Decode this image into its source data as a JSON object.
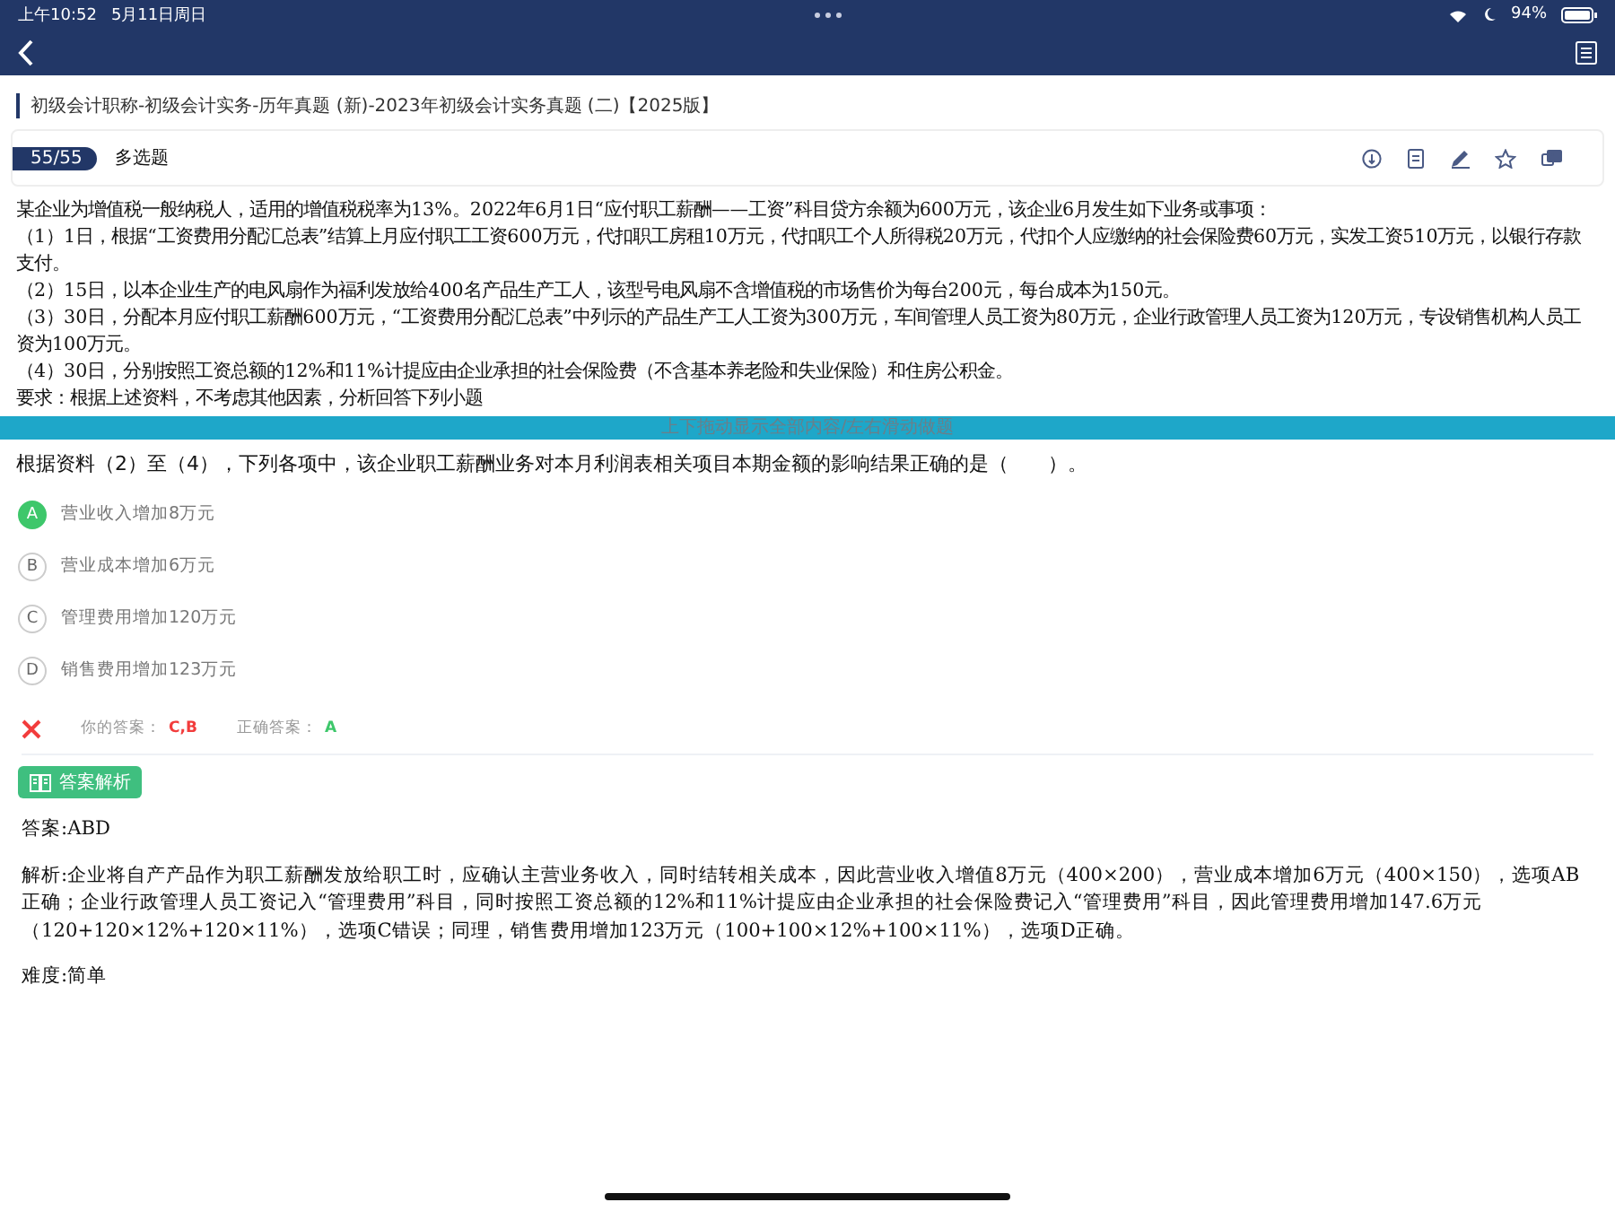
{
  "status_bar": {
    "time": "上午10:52",
    "date": "5月11日周日",
    "battery": "94%"
  },
  "breadcrumb": "初级会计职称-初级会计实务-历年真题 (新)-2023年初级会计实务真题 (二)【2025版】",
  "question_header": {
    "progress": "55/55",
    "type": "多选题"
  },
  "material": [
    "某企业为增值税一般纳税人，适用的增值税税率为13%。2022年6月1日“应付职工薪酬——工资”科目贷方余额为600万元，该企业6月发生如下业务或事项：",
    "（1）1日，根据“工资费用分配汇总表”结算上月应付职工工资600万元，代扣职工房租10万元，代扣职工个人所得税20万元，代扣个人应缴纳的社会保险费60万元，实发工资510万元，以银行存款支付。",
    "（2）15日，以本企业生产的电风扇作为福利发放给400名产品生产工人，该型号电风扇不含增值税的市场售价为每台200元，每台成本为150元。",
    "（3）30日，分配本月应付职工薪酬600万元，“工资费用分配汇总表”中列示的产品生产工人工资为300万元，车间管理人员工资为80万元，企业行政管理人员工资为120万元，专设销售机构人员工资为100万元。",
    "（4）30日，分别按照工资总额的12%和11%计提应由企业承担的社会保险费（不含基本养老险和失业保险）和住房公积金。",
    "要求：根据上述资料，不考虑其他因素，分析回答下列小题"
  ],
  "drag_hint": "上下拖动显示全部内容/左右滑动做题",
  "question": "根据资料（2）至（4），下列各项中，该企业职工薪酬业务对本月利润表相关项目本期金额的影响结果正确的是（　　）。",
  "options": [
    {
      "letter": "A",
      "text": "营业收入增加8万元",
      "correct": true
    },
    {
      "letter": "B",
      "text": "营业成本增加6万元",
      "correct": false
    },
    {
      "letter": "C",
      "text": "管理费用增加120万元",
      "correct": false
    },
    {
      "letter": "D",
      "text": "销售费用增加123万元",
      "correct": false
    }
  ],
  "result": {
    "wrong": true,
    "your_answer_label": "你的答案：",
    "your_answer": "C,B",
    "correct_answer_label": "正确答案：",
    "correct_answer": "A"
  },
  "analysis_button": "答案解析",
  "answer": "答案:ABD",
  "explanation": "解析:企业将自产产品作为职工薪酬发放给职工时，应确认主营业务收入，同时结转相关成本，因此营业收入增值8万元（400×200），营业成本增加6万元（400×150），选项AB正确；企业行政管理人员工资记入“管理费用”科目，同时按照工资总额的12%和11%计提应由企业承担的社会保险费记入“管理费用”科目，因此管理费用增加147.6万元（120+120×12%+120×11%），选项C错误；同理，销售费用增加123万元（100+100×12%+100×11%），选项D正确。",
  "difficulty": "难度:简单"
}
